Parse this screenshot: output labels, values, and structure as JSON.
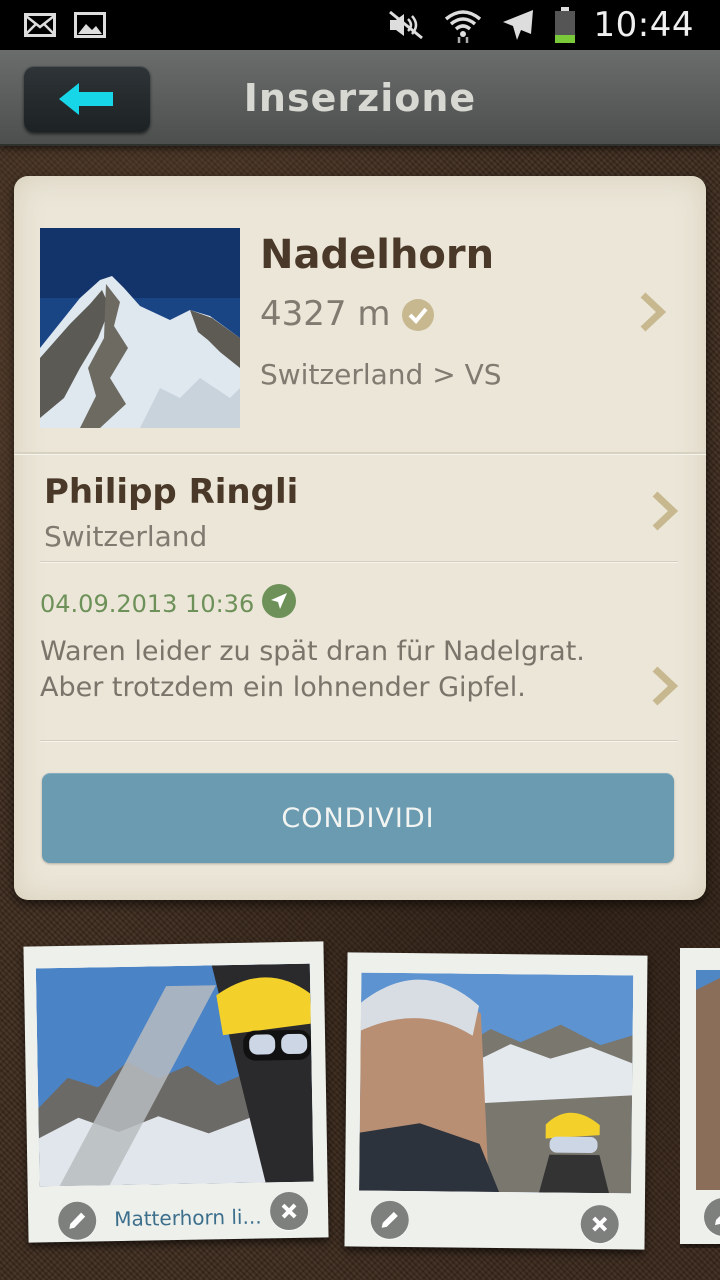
{
  "status_bar": {
    "time": "10:44",
    "icons": [
      "mail-icon",
      "image-icon",
      "mute-icon",
      "wifi-icon",
      "airplane-icon",
      "battery-icon"
    ]
  },
  "header": {
    "title": "Inserzione",
    "back_icon": "arrow-left-icon"
  },
  "peak": {
    "name": "Nadelhorn",
    "height": "4327 m",
    "location": "Switzerland > VS",
    "verified_icon": "check-circle-icon"
  },
  "user": {
    "name": "Philipp Ringli",
    "country": "Switzerland"
  },
  "post": {
    "datetime": "04.09.2013 10:36",
    "text_line1": "Waren leider zu spät dran für Nadelgrat.",
    "text_line2": "Aber trotzdem ein lohnender Gipfel.",
    "gps_icon": "location-arrow-icon"
  },
  "actions": {
    "share_label": "CONDIVIDI"
  },
  "photos": [
    {
      "caption": "Matterhorn li...",
      "edit_icon": "pencil-icon",
      "delete_icon": "close-icon"
    },
    {
      "caption": "",
      "edit_icon": "pencil-icon",
      "delete_icon": "close-icon"
    }
  ],
  "colors": {
    "accent_cyan": "#17d6e8",
    "share_button": "#6b9bb1",
    "date_green": "#6d9158",
    "chevron": "#c7b88f",
    "card_bg": "#ebe6d8"
  }
}
